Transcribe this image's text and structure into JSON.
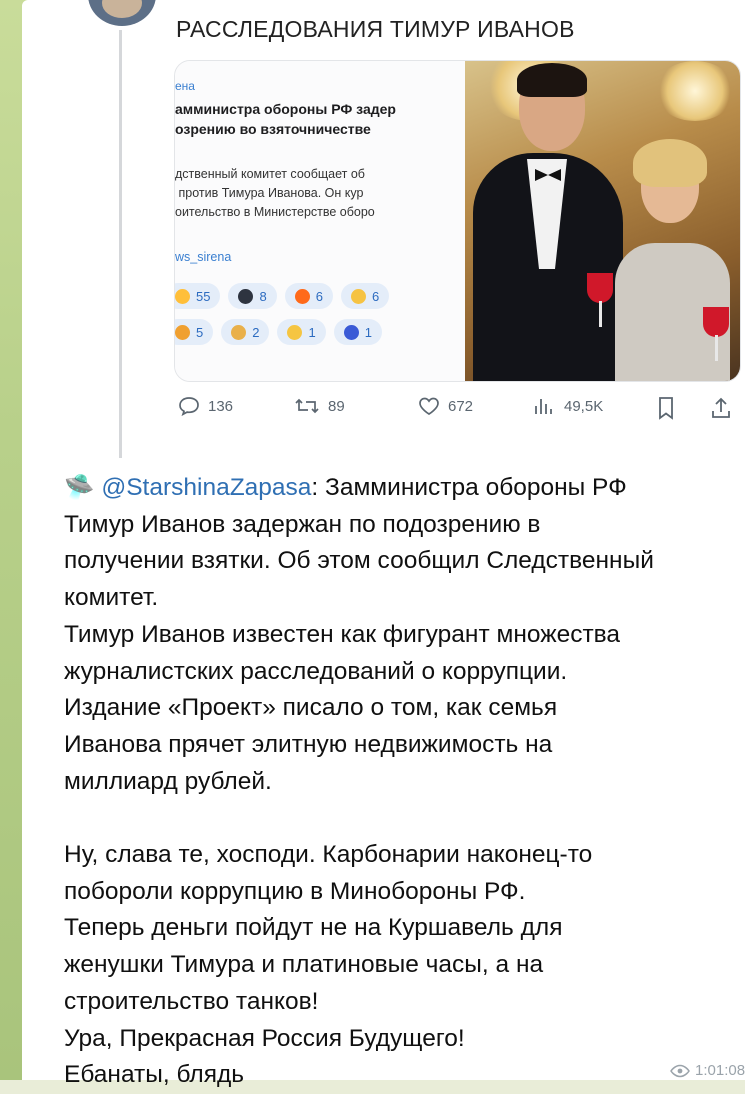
{
  "post": {
    "title": "РАССЛЕДОВАНИЯ ТИМУР ИВАНОВ"
  },
  "embed": {
    "source": "ена",
    "headline": "амминистра обороны РФ задер\nозрению во взяточничестве",
    "body": "дственный комитет сообщает об\n против Тимура Иванова. Он кур\nоительство в Министерстве оборо",
    "link": "ws_sirena",
    "reactions_row1": [
      {
        "icon": "bomb-emoji",
        "count": "55",
        "color": "#ffbf3a"
      },
      {
        "icon": "bomb-emoji",
        "count": "8",
        "color": "#2e3440"
      },
      {
        "icon": "fire-emoji",
        "count": "6",
        "color": "#ff6a1a"
      },
      {
        "icon": "scream-emoji",
        "count": "6",
        "color": "#f6c343"
      }
    ],
    "reactions_row2": [
      {
        "icon": "clown-emoji",
        "count": "5",
        "color": "#f0a030"
      },
      {
        "icon": "praying-emoji",
        "count": "2",
        "color": "#e9b04a"
      },
      {
        "icon": "thinking-emoji",
        "count": "1",
        "color": "#f5c542"
      },
      {
        "icon": "cool-emoji",
        "count": "1",
        "color": "#3b5bd6"
      }
    ]
  },
  "stats": {
    "replies": "136",
    "reposts": "89",
    "likes": "672",
    "views": "49,5K"
  },
  "message": {
    "prefix_emoji": "🛸",
    "mention": "@StarshinaZapasa",
    "after_mention": ": Замминистра обороны РФ",
    "lines": [
      "Тимур Иванов задержан по подозрению в",
      "получении взятки. Об этом сообщил Следственный",
      "комитет.",
      "Тимур Иванов известен как фигурант множества",
      "журналистских расследований о коррупции.",
      "Издание «Проект» писало о том, как семья",
      "Иванова прячет элитную недвижимость на",
      "миллиард рублей."
    ],
    "lines2": [
      "Ну, слава те, хосподи. Карбонарии наконец-то",
      "побороли коррупцию в Минобороны РФ.",
      "Теперь деньги пойдут не на Куршавель для",
      "женушки Тимура и платиновые часы, а на",
      "строительство танков!",
      "Ура, Прекрасная Россия Будущего!",
      "Ебанаты, блядь"
    ]
  },
  "meta": {
    "time": "1:01:08"
  }
}
